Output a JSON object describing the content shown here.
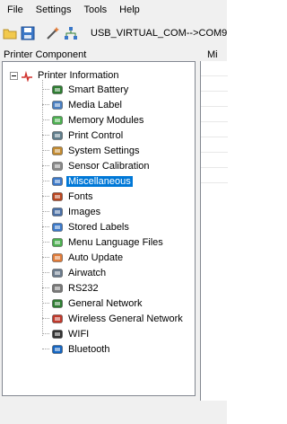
{
  "menu": [
    "File",
    "Settings",
    "Tools",
    "Help"
  ],
  "toolbar": {
    "connection": "USB_VIRTUAL_COM-->COM9"
  },
  "panel": {
    "title": "Printer Component",
    "right_title": "Mi"
  },
  "tree": {
    "root": "Printer Information",
    "items": [
      {
        "label": "Smart Battery",
        "icon": "battery-icon",
        "color": "#2e7d32"
      },
      {
        "label": "Media Label",
        "icon": "media-label-icon",
        "color": "#4a7fc1"
      },
      {
        "label": "Memory Modules",
        "icon": "memory-icon",
        "color": "#4caf50"
      },
      {
        "label": "Print Control",
        "icon": "printer-icon",
        "color": "#607d8b"
      },
      {
        "label": "System Settings",
        "icon": "wrench-icon",
        "color": "#c28a30"
      },
      {
        "label": "Sensor Calibration",
        "icon": "sensor-icon",
        "color": "#8a8a8a"
      },
      {
        "label": "Miscellaneous",
        "icon": "misc-icon",
        "color": "#3b78c8"
      },
      {
        "label": "Fonts",
        "icon": "font-icon",
        "color": "#b8451f"
      },
      {
        "label": "Images",
        "icon": "images-icon",
        "color": "#4a6fa5"
      },
      {
        "label": "Stored Labels",
        "icon": "stored-labels-icon",
        "color": "#3b78c8"
      },
      {
        "label": "Menu Language Files",
        "icon": "language-icon",
        "color": "#4caf50"
      },
      {
        "label": "Auto Update",
        "icon": "auto-update-icon",
        "color": "#e07b39"
      },
      {
        "label": "Airwatch",
        "icon": "airwatch-icon",
        "color": "#6b7b8c"
      },
      {
        "label": "RS232",
        "icon": "rs232-icon",
        "color": "#777777"
      },
      {
        "label": "General Network",
        "icon": "network-icon",
        "color": "#2e7d32"
      },
      {
        "label": "Wireless General Network",
        "icon": "wireless-network-icon",
        "color": "#c0392b"
      },
      {
        "label": "WIFI",
        "icon": "wifi-icon",
        "color": "#333333"
      },
      {
        "label": "Bluetooth",
        "icon": "bluetooth-icon",
        "color": "#1565c0"
      }
    ],
    "selected_index": 6
  }
}
